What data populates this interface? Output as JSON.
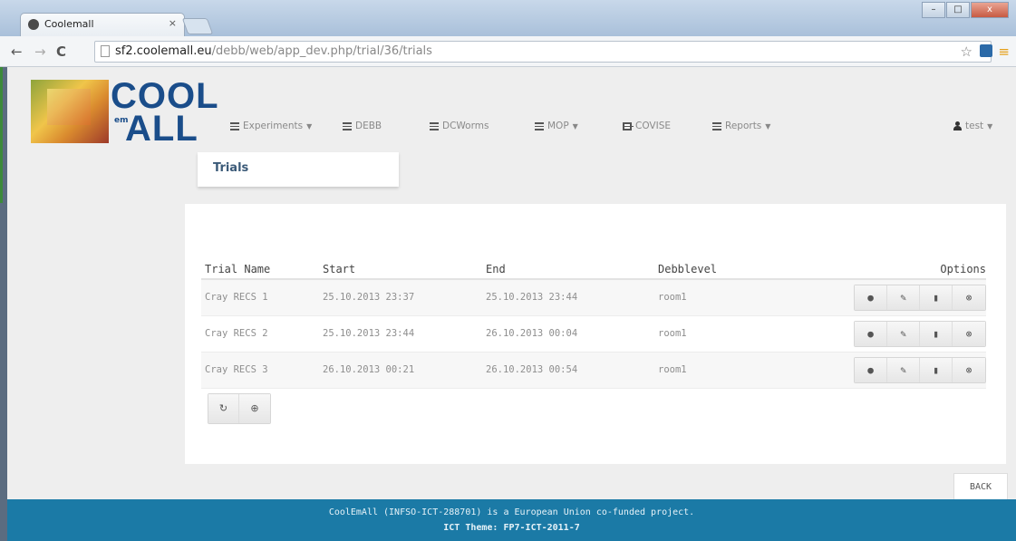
{
  "browser": {
    "tab_title": "Coolemall",
    "tab_close": "×",
    "url_host": "sf2.coolemall.eu",
    "url_path": "/debb/web/app_dev.php/trial/36/trials",
    "window_buttons": [
      "–",
      "□",
      "x"
    ]
  },
  "navbar": {
    "logo_top": "COOL",
    "logo_bottom": "ALL",
    "logo_mark": "em",
    "items": [
      {
        "label": "Experiments",
        "icon": "list-icon",
        "dropdown": true
      },
      {
        "label": "DEBB",
        "icon": "list-icon",
        "dropdown": false
      },
      {
        "label": "DCWorms",
        "icon": "list-icon",
        "dropdown": false
      },
      {
        "label": "MOP",
        "icon": "list-icon",
        "dropdown": true
      },
      {
        "label": "COVISE",
        "icon": "cube-icon",
        "dropdown": false
      },
      {
        "label": "Reports",
        "icon": "list-icon",
        "dropdown": true
      }
    ],
    "user": "test"
  },
  "page": {
    "title": "Trials",
    "back_label": "BACK"
  },
  "table": {
    "headers": [
      "Trial Name",
      "Start",
      "End",
      "Debblevel",
      "Options"
    ],
    "rows": [
      {
        "name": "Cray RECS 1",
        "start": "25.10.2013 23:37",
        "end": "25.10.2013 23:44",
        "level": "room1"
      },
      {
        "name": "Cray RECS 2",
        "start": "25.10.2013 23:44",
        "end": "26.10.2013 00:04",
        "level": "room1"
      },
      {
        "name": "Cray RECS 3",
        "start": "26.10.2013 00:21",
        "end": "26.10.2013 00:54",
        "level": "room1"
      }
    ],
    "option_icons": [
      "view-icon",
      "edit-icon",
      "delete-icon",
      "settings-icon"
    ]
  },
  "tools": [
    "refresh-icon",
    "add-icon"
  ],
  "footer": {
    "line1": "CoolEmAll (INFSO-ICT-288701) is a European Union co-funded project.",
    "line2": "ICT Theme: FP7-ICT-2011-7"
  }
}
